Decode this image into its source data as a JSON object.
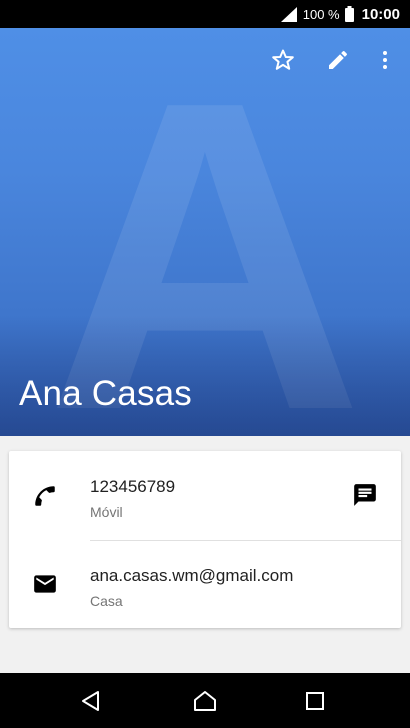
{
  "status_bar": {
    "battery_text": "100 %",
    "time": "10:00"
  },
  "contact": {
    "name": "Ana Casas",
    "watermark_letter": "A"
  },
  "header_actions": [
    "star-icon",
    "edit-icon",
    "more-vert-icon"
  ],
  "phone": {
    "number": "123456789",
    "type": "Móvil",
    "icon": "phone-icon",
    "action_icon": "message-icon"
  },
  "email": {
    "address": "ana.casas.wm@gmail.com",
    "type": "Casa",
    "icon": "email-icon"
  },
  "navigation": [
    "back-icon",
    "home-icon",
    "recents-icon"
  ],
  "colors": {
    "header_top": "#4f8fe6",
    "header_bottom": "#2f5bb0",
    "background": "#f1f1f1",
    "bars": "#000000"
  }
}
